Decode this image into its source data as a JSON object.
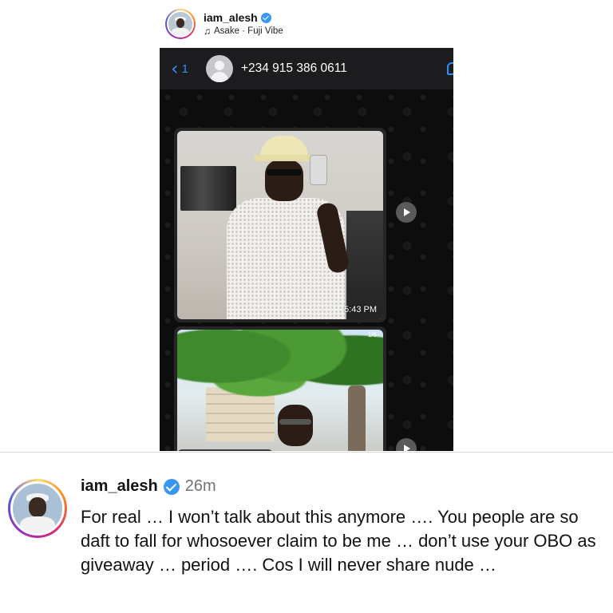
{
  "story_header": {
    "username": "iam_alesh",
    "music": "Asake · Fuji Vibe",
    "music_icon": "music-note-icon"
  },
  "chat": {
    "back_count": "1",
    "contact": "+234 915 386 0611",
    "messages": [
      {
        "type": "image",
        "timestamp": "5:43 PM"
      },
      {
        "type": "image",
        "counter": "1/6"
      }
    ],
    "accent_color": "#2f8ef4"
  },
  "caption": {
    "username": "iam_alesh",
    "time": "26m",
    "text": "For real … I won’t talk about this anymore …. You people are so daft to fall for whosoever claim to be me … don’t use your OBO as giveaway … period …. Cos I will never share nude …"
  },
  "colors": {
    "verified_badge": "#3897f0",
    "timestamp_gray": "#737373"
  }
}
